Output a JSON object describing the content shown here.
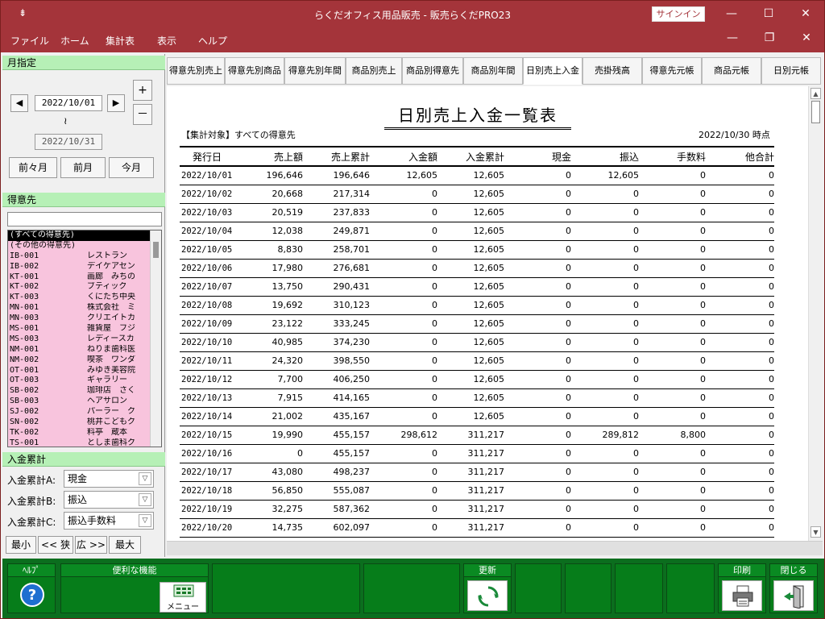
{
  "window": {
    "title": "らくだオフィス用品販売 - 販売らくだPRO23",
    "signin_label": "サインイン"
  },
  "menu": [
    "ファイル",
    "ホーム",
    "集計表",
    "表示",
    "ヘルプ"
  ],
  "left": {
    "month_header": "月指定",
    "date_from": "2022/10/01",
    "date_sep": "≀",
    "date_to": "2022/10/31",
    "plus": "+",
    "minus": "－",
    "prev_btn": "◀",
    "next_btn": "▶",
    "month_buttons": [
      "前々月",
      "前月",
      "今月"
    ],
    "customer_header": "得意先",
    "customers": [
      {
        "code": "(すべての得意先)",
        "name": ""
      },
      {
        "code": "(その他の得意先)",
        "name": ""
      },
      {
        "code": "IB-001",
        "name": "レストラン　"
      },
      {
        "code": "IB-002",
        "name": "デイケアセン"
      },
      {
        "code": "KT-001",
        "name": "画廊　みちの"
      },
      {
        "code": "KT-002",
        "name": "ブティック　"
      },
      {
        "code": "KT-003",
        "name": "くにたち中央"
      },
      {
        "code": "MN-001",
        "name": "株式会社　ミ"
      },
      {
        "code": "MN-003",
        "name": "クリエイトカ"
      },
      {
        "code": "MS-001",
        "name": "雑貨屋　フジ"
      },
      {
        "code": "MS-003",
        "name": "レディースカ"
      },
      {
        "code": "NM-001",
        "name": "ねりま歯科医"
      },
      {
        "code": "NM-002",
        "name": "喫茶　ワンダ"
      },
      {
        "code": "OT-001",
        "name": "みゆき美容院"
      },
      {
        "code": "OT-003",
        "name": "ギャラリー　"
      },
      {
        "code": "SB-002",
        "name": "珈琲店　さく"
      },
      {
        "code": "SB-003",
        "name": "ヘアサロン　"
      },
      {
        "code": "SJ-002",
        "name": "パーラー　ク"
      },
      {
        "code": "SN-002",
        "name": "桃井こどもク"
      },
      {
        "code": "TK-002",
        "name": "料亭　蔵本　"
      },
      {
        "code": "TS-001",
        "name": "としま歯科ク"
      }
    ],
    "deposit_header": "入金累計",
    "deposit_a_label": "入金累計A:",
    "deposit_a_value": "現金",
    "deposit_b_label": "入金累計B:",
    "deposit_b_value": "振込",
    "deposit_c_label": "入金累計C:",
    "deposit_c_value": "振込手数料",
    "zoom": [
      "最小",
      "<< 狭",
      "広 >>",
      "最大"
    ]
  },
  "tabs": [
    "得意先別売上",
    "得意先別商品",
    "得意先別年間",
    "商品別売上",
    "商品別得意先",
    "商品別年間",
    "日別売上入金",
    "売掛残高",
    "得意先元帳",
    "商品元帳",
    "日別元帳"
  ],
  "active_tab": "日別売上入金",
  "report": {
    "title": "日別売上入金一覧表",
    "target": "【集計対象】すべての得意先",
    "as_of": "2022/10/30 時点",
    "columns": [
      "発行日",
      "売上額",
      "売上累計",
      "入金額",
      "入金累計",
      "現金",
      "振込",
      "手数料",
      "他合計"
    ],
    "rows": [
      [
        "2022/10/01",
        "196,646",
        "196,646",
        "12,605",
        "12,605",
        "0",
        "12,605",
        "0",
        "0"
      ],
      [
        "2022/10/02",
        "20,668",
        "217,314",
        "0",
        "12,605",
        "0",
        "0",
        "0",
        "0"
      ],
      [
        "2022/10/03",
        "20,519",
        "237,833",
        "0",
        "12,605",
        "0",
        "0",
        "0",
        "0"
      ],
      [
        "2022/10/04",
        "12,038",
        "249,871",
        "0",
        "12,605",
        "0",
        "0",
        "0",
        "0"
      ],
      [
        "2022/10/05",
        "8,830",
        "258,701",
        "0",
        "12,605",
        "0",
        "0",
        "0",
        "0"
      ],
      [
        "2022/10/06",
        "17,980",
        "276,681",
        "0",
        "12,605",
        "0",
        "0",
        "0",
        "0"
      ],
      [
        "2022/10/07",
        "13,750",
        "290,431",
        "0",
        "12,605",
        "0",
        "0",
        "0",
        "0"
      ],
      [
        "2022/10/08",
        "19,692",
        "310,123",
        "0",
        "12,605",
        "0",
        "0",
        "0",
        "0"
      ],
      [
        "2022/10/09",
        "23,122",
        "333,245",
        "0",
        "12,605",
        "0",
        "0",
        "0",
        "0"
      ],
      [
        "2022/10/10",
        "40,985",
        "374,230",
        "0",
        "12,605",
        "0",
        "0",
        "0",
        "0"
      ],
      [
        "2022/10/11",
        "24,320",
        "398,550",
        "0",
        "12,605",
        "0",
        "0",
        "0",
        "0"
      ],
      [
        "2022/10/12",
        "7,700",
        "406,250",
        "0",
        "12,605",
        "0",
        "0",
        "0",
        "0"
      ],
      [
        "2022/10/13",
        "7,915",
        "414,165",
        "0",
        "12,605",
        "0",
        "0",
        "0",
        "0"
      ],
      [
        "2022/10/14",
        "21,002",
        "435,167",
        "0",
        "12,605",
        "0",
        "0",
        "0",
        "0"
      ],
      [
        "2022/10/15",
        "19,990",
        "455,157",
        "298,612",
        "311,217",
        "0",
        "289,812",
        "8,800",
        "0"
      ],
      [
        "2022/10/16",
        "0",
        "455,157",
        "0",
        "311,217",
        "0",
        "0",
        "0",
        "0"
      ],
      [
        "2022/10/17",
        "43,080",
        "498,237",
        "0",
        "311,217",
        "0",
        "0",
        "0",
        "0"
      ],
      [
        "2022/10/18",
        "56,850",
        "555,087",
        "0",
        "311,217",
        "0",
        "0",
        "0",
        "0"
      ],
      [
        "2022/10/19",
        "32,275",
        "587,362",
        "0",
        "311,217",
        "0",
        "0",
        "0",
        "0"
      ],
      [
        "2022/10/20",
        "14,735",
        "602,097",
        "0",
        "311,217",
        "0",
        "0",
        "0",
        "0"
      ]
    ]
  },
  "bottom": {
    "help_label": "ﾍﾙﾌﾟ",
    "tools_label": "便利な機能",
    "menu_label": "メニュー",
    "refresh_label": "更新",
    "print_label": "印刷",
    "close_label": "閉じる"
  }
}
